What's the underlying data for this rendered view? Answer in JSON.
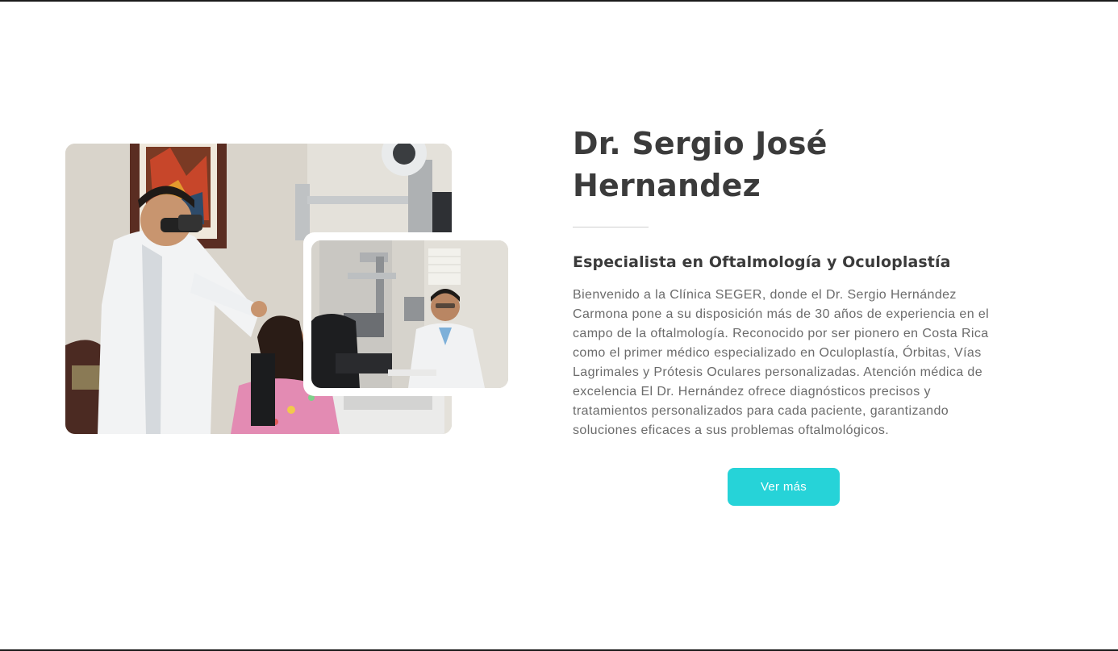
{
  "about": {
    "name_line1": "Dr. Sergio José",
    "name_line2": "Hernandez",
    "specialty": "Especialista en Oftalmología y Oculoplastía",
    "description": "Bienvenido a la Clínica SEGER, donde el Dr. Sergio Hernández Carmona pone a su disposición más de 30 años de experiencia en el campo de la oftalmología. Reconocido por ser pionero en Costa Rica como el primer médico especializado en Oculoplastía, Órbitas, Vías Lagrimales y Prótesis Oculares personalizadas. Atención médica de excelencia El Dr. Hernández ofrece diagnósticos precisos y tratamientos personalizados para cada paciente, garantizando soluciones eficaces a sus problemas oftalmológicos.",
    "button_label": "Ver más"
  },
  "colors": {
    "accent": "#26d3d8",
    "heading": "#3b3b3b",
    "body_text": "#6b6b6b",
    "divider": "#cfcfcf"
  }
}
